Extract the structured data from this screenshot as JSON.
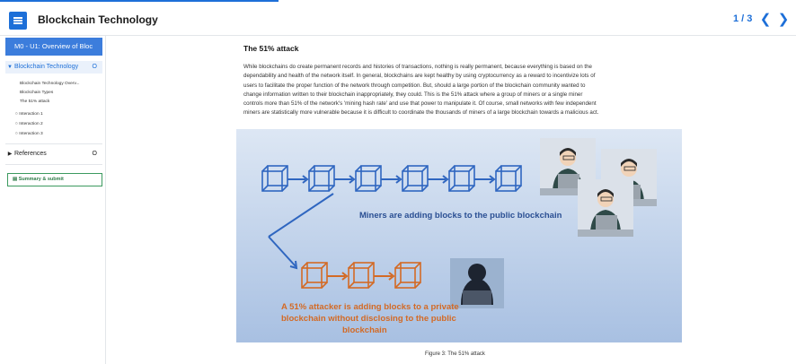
{
  "header": {
    "title": "Blockchain Technology",
    "page_indicator": "1 / 3",
    "prev_icon": "chevron-left-icon",
    "next_icon": "chevron-right-icon"
  },
  "sidebar": {
    "module_label": "M0 - U1: Overview of Bloc",
    "section_title": "Blockchain Technology",
    "section_dot": "O",
    "items": [
      "Blockchain Technology Overv...",
      "Blockchain Types",
      "The 51% attack"
    ],
    "interactions": [
      "Interaction 1",
      "Interaction 2",
      "Interaction 3"
    ],
    "references_label": "References",
    "references_dot": "O",
    "summary_label": "Summary & submit"
  },
  "article": {
    "title": "The 51% attack",
    "paragraph_lines": [
      "While blockchains do create permanent records and histories of transactions, nothing is really permanent, because everything is based on the",
      "dependability and health of the network itself. In general, blockchains are kept healthy by using cryptocurrency as a reward to incentivize lots of",
      "users to facilitate the proper function of the network through competition.  But, should a large portion of the blockchain community wanted to",
      "change information written to their blockchain inappropriately, they could. This is the 51% attack where a group of miners or a single miner",
      "controls more than 51% of the network's 'mining hash rate' and use that power to manipulate it. Of course, small networks with few independent",
      "miners are statistically more vulnerable because it is difficult to coordinate the thousands of miners of a large blockchain towards a malicious act."
    ],
    "figure": {
      "miners_text": "Miners are adding blocks to the public blockchain",
      "attacker_lines": [
        "A 51% attacker is adding blocks to a private",
        "blockchain without disclosing to the public",
        "blockchain"
      ],
      "laptop_label": "</>",
      "colors": {
        "bg_top": "#dde7f4",
        "bg_bottom": "#a8c0e2",
        "blue": "#2f66c0",
        "orange": "#d36a25",
        "text_blue": "#2a4f93",
        "text_orange": "#d36a25"
      }
    },
    "caption": "Figure 3: The 51% attack"
  }
}
